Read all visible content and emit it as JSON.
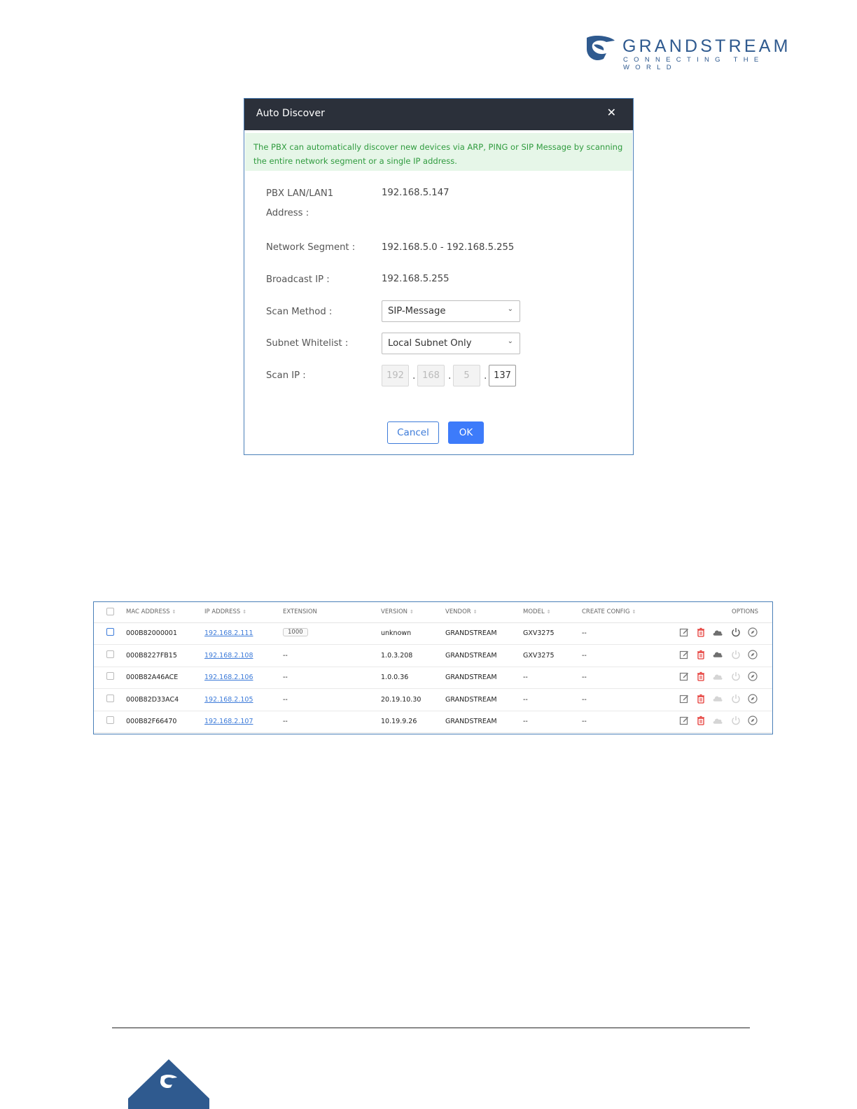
{
  "brand": {
    "name": "GRANDSTREAM",
    "tagline": "CONNECTING THE WORLD",
    "color": "#2f5a8f"
  },
  "dialog": {
    "title": "Auto Discover",
    "close_icon": "close-icon",
    "note": "The PBX can automatically discover new devices via ARP, PING or SIP Message by scanning the entire network segment or a single IP address.",
    "fields": {
      "pbx_lan_label_line1": "PBX LAN/LAN1",
      "pbx_lan_label_line2": "Address :",
      "pbx_lan_value": "192.168.5.147",
      "network_segment_label": "Network Segment :",
      "network_segment_value": "192.168.5.0 - 192.168.5.255",
      "broadcast_ip_label": "Broadcast IP :",
      "broadcast_ip_value": "192.168.5.255",
      "scan_method_label": "Scan Method :",
      "scan_method_value": "SIP-Message",
      "subnet_whitelist_label": "Subnet Whitelist :",
      "subnet_whitelist_value": "Local Subnet Only",
      "scan_ip_label": "Scan IP :",
      "scan_ip_octets": [
        "192",
        "168",
        "5",
        "137"
      ]
    },
    "buttons": {
      "cancel": "Cancel",
      "ok": "OK"
    }
  },
  "device_table": {
    "headers": {
      "mac": "MAC ADDRESS",
      "ip": "IP ADDRESS",
      "extension": "EXTENSION",
      "version": "VERSION",
      "vendor": "VENDOR",
      "model": "MODEL",
      "create_config": "CREATE CONFIG",
      "options": "OPTIONS"
    },
    "rows": [
      {
        "mac": "000B82000001",
        "ip": "192.168.2.111",
        "extension": "1000",
        "version": "unknown",
        "vendor": "GRANDSTREAM",
        "model": "GXV3275",
        "create_config": "--"
      },
      {
        "mac": "000B8227FB15",
        "ip": "192.168.2.108",
        "extension": "--",
        "version": "1.0.3.208",
        "vendor": "GRANDSTREAM",
        "model": "GXV3275",
        "create_config": "--"
      },
      {
        "mac": "000B82A46ACE",
        "ip": "192.168.2.106",
        "extension": "--",
        "version": "1.0.0.36",
        "vendor": "GRANDSTREAM",
        "model": "--",
        "create_config": "--"
      },
      {
        "mac": "000B82D33AC4",
        "ip": "192.168.2.105",
        "extension": "--",
        "version": "20.19.10.30",
        "vendor": "GRANDSTREAM",
        "model": "--",
        "create_config": "--"
      },
      {
        "mac": "000B82F66470",
        "ip": "192.168.2.107",
        "extension": "--",
        "version": "10.19.9.26",
        "vendor": "GRANDSTREAM",
        "model": "--",
        "create_config": "--"
      }
    ],
    "option_icons": [
      "edit-icon",
      "delete-icon",
      "cloud-icon",
      "power-icon",
      "compass-icon"
    ]
  }
}
